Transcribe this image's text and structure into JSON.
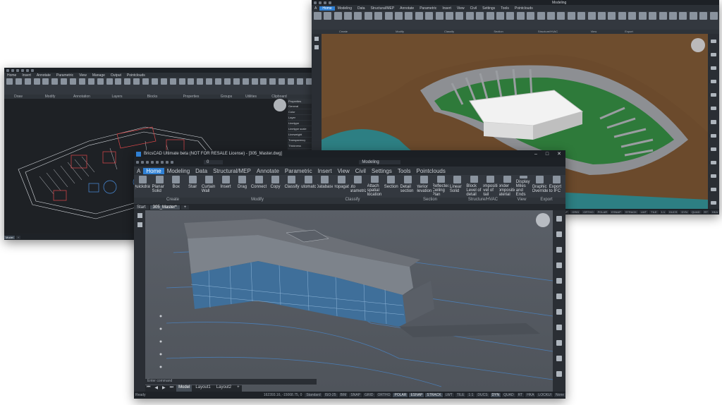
{
  "win3": {
    "title": "BricsCAD Ultimate beta (NOT FOR RESALE License) - [305_Master.dwg]",
    "workspace": "Modeling",
    "layer": "0",
    "ribbon_tabs": [
      "A",
      "Home",
      "Modeling",
      "Data",
      "Structural/MEP",
      "Annotate",
      "Parametric",
      "Insert",
      "View",
      "Civil",
      "Settings",
      "Tools",
      "Pointclouds"
    ],
    "ribbon_buttons": [
      "Quickdraw",
      "Planar Solid",
      "Box",
      "Stair",
      "Curtain Wall",
      "Insert",
      "Drag",
      "Connect",
      "Copy",
      "Classify",
      "Automatch",
      "Database",
      "Propagate",
      "Auto Parametrize",
      "Attach spatial location",
      "Section",
      "Detail section",
      "Interior elevations",
      "Reflected Ceiling Plan",
      "Linear Solid",
      "Block Level of detail",
      "Composition Level of detail",
      "Render Composition Material",
      "Display Miles and Ends",
      "Graphic Override",
      "Export to IFC"
    ],
    "groups": [
      "Create",
      "Modify",
      "Classify",
      "Section",
      "Structure/HVAC",
      "View",
      "Export"
    ],
    "doc_tabs": [
      "Start",
      "305_Master*",
      "+"
    ],
    "layout_tabs": [
      "Model",
      "Layout1",
      "Layout2",
      "+"
    ],
    "status_left": "Ready",
    "coords": "162393.16, -15068.75, 0",
    "status_items": [
      "Standard",
      "ISO-25",
      "BIM",
      "SNAP",
      "GRID",
      "ORTHO",
      "POLAR",
      "ESNAP",
      "STRACK",
      "LWT",
      "TILE",
      "1:1",
      "DUCS",
      "DYN",
      "QUAD",
      "RT",
      "HKA",
      "LOCKUI",
      "None"
    ],
    "command_prompt": "Enter command"
  },
  "win2": {
    "title": "Modeling",
    "ribbon_tabs": [
      "A",
      "Home",
      "Modeling",
      "Data",
      "Structural/MEP",
      "Annotate",
      "Parametric",
      "Insert",
      "View",
      "Civil",
      "Settings",
      "Tools",
      "Pointclouds"
    ],
    "groups": [
      "Create",
      "Modify",
      "Classify",
      "Section",
      "Structure/HVAC",
      "View",
      "Export"
    ],
    "status_items": [
      "Standard",
      "ISO-25",
      "BIM",
      "SNAP",
      "GRID",
      "ORTHO",
      "POLAR",
      "ESNAP",
      "STRACK",
      "LWT",
      "TILE",
      "1:1",
      "DUCS",
      "DYN",
      "QUAD",
      "RT",
      "HKA"
    ]
  },
  "win1": {
    "ribbon_tabs": [
      "Home",
      "Insert",
      "Annotate",
      "Parametric",
      "View",
      "Manage",
      "Output",
      "Pointclouds"
    ],
    "groups": [
      "Draw",
      "Modify",
      "Annotation",
      "Layers",
      "Blocks",
      "Properties",
      "Groups",
      "Utilities",
      "Clipboard"
    ],
    "panel_title": "Properties",
    "panel_rows": [
      "General",
      "Color",
      "Layer",
      "Linetype",
      "Linetype scale",
      "Lineweight",
      "Transparency",
      "Thickness",
      "3D Visualization",
      "Material",
      "Geometry"
    ],
    "layout_tabs": [
      "Model",
      "+"
    ]
  },
  "colors": {
    "accent": "#2f80d4",
    "lot_green": "#2e7a3a",
    "terrain_brown": "#6b4a2c",
    "water": "#2d7f83",
    "plan_red": "#e0484a"
  }
}
